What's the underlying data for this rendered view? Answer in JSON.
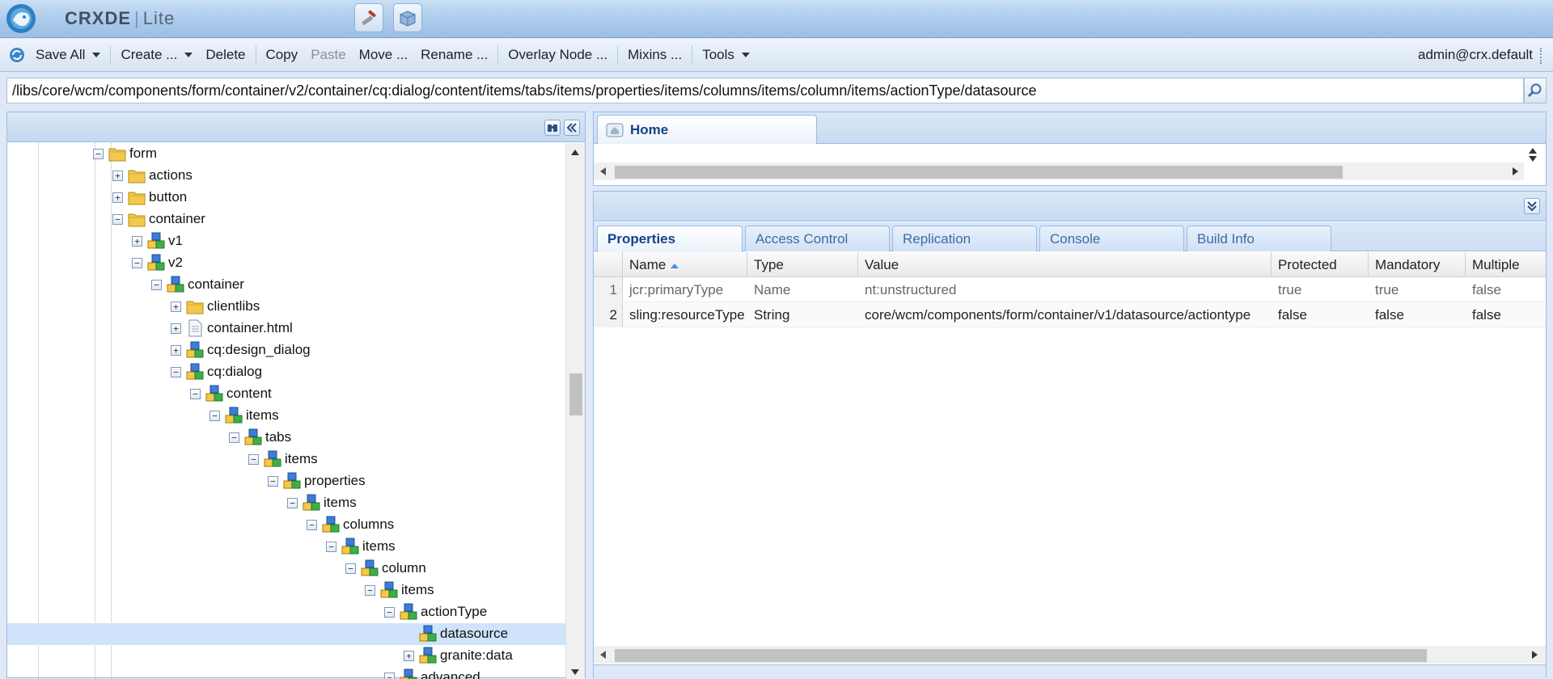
{
  "app": {
    "name_part1": "CRXDE",
    "name_part2": "Lite"
  },
  "toolbar": {
    "save_all": "Save All",
    "create": "Create ...",
    "delete": "Delete",
    "copy": "Copy",
    "paste": "Paste",
    "move": "Move ...",
    "rename": "Rename ...",
    "overlay_node": "Overlay Node ...",
    "mixins": "Mixins ...",
    "tools": "Tools",
    "user": "admin@crx.default"
  },
  "path": {
    "value": "/libs/core/wcm/components/form/container/v2/container/cq:dialog/content/items/tabs/items/properties/items/columns/items/column/items/actionType/datasource"
  },
  "tree": {
    "nodes": [
      {
        "label": "form",
        "depth": 0,
        "toggle": "minus",
        "icon": "folder"
      },
      {
        "label": "actions",
        "depth": 1,
        "toggle": "plus",
        "icon": "folder"
      },
      {
        "label": "button",
        "depth": 1,
        "toggle": "plus",
        "icon": "folder"
      },
      {
        "label": "container",
        "depth": 1,
        "toggle": "minus",
        "icon": "folder"
      },
      {
        "label": "v1",
        "depth": 2,
        "toggle": "plus",
        "icon": "node"
      },
      {
        "label": "v2",
        "depth": 2,
        "toggle": "minus",
        "icon": "node"
      },
      {
        "label": "container",
        "depth": 3,
        "toggle": "minus",
        "icon": "node"
      },
      {
        "label": "clientlibs",
        "depth": 4,
        "toggle": "plus",
        "icon": "folder"
      },
      {
        "label": "container.html",
        "depth": 4,
        "toggle": "plus",
        "icon": "file"
      },
      {
        "label": "cq:design_dialog",
        "depth": 4,
        "toggle": "plus",
        "icon": "node"
      },
      {
        "label": "cq:dialog",
        "depth": 4,
        "toggle": "minus",
        "icon": "node"
      },
      {
        "label": "content",
        "depth": 5,
        "toggle": "minus",
        "icon": "node"
      },
      {
        "label": "items",
        "depth": 6,
        "toggle": "minus",
        "icon": "node"
      },
      {
        "label": "tabs",
        "depth": 7,
        "toggle": "minus",
        "icon": "node"
      },
      {
        "label": "items",
        "depth": 8,
        "toggle": "minus",
        "icon": "node"
      },
      {
        "label": "properties",
        "depth": 9,
        "toggle": "minus",
        "icon": "node"
      },
      {
        "label": "items",
        "depth": 10,
        "toggle": "minus",
        "icon": "node"
      },
      {
        "label": "columns",
        "depth": 11,
        "toggle": "minus",
        "icon": "node"
      },
      {
        "label": "items",
        "depth": 12,
        "toggle": "minus",
        "icon": "node"
      },
      {
        "label": "column",
        "depth": 13,
        "toggle": "minus",
        "icon": "node"
      },
      {
        "label": "items",
        "depth": 14,
        "toggle": "minus",
        "icon": "node"
      },
      {
        "label": "actionType",
        "depth": 15,
        "toggle": "minus",
        "icon": "node"
      },
      {
        "label": "datasource",
        "depth": 16,
        "toggle": "none",
        "icon": "node",
        "selected": true
      },
      {
        "label": "granite:data",
        "depth": 16,
        "toggle": "plus",
        "icon": "node"
      },
      {
        "label": "advanced",
        "depth": 15,
        "toggle": "minus",
        "icon": "node"
      }
    ]
  },
  "home_tab": {
    "label": "Home"
  },
  "properties": {
    "tabs": [
      "Properties",
      "Access Control",
      "Replication",
      "Console",
      "Build Info"
    ],
    "columns": [
      "Name",
      "Type",
      "Value",
      "Protected",
      "Mandatory",
      "Multiple"
    ],
    "rows": [
      {
        "num": "1",
        "name": "jcr:primaryType",
        "type": "Name",
        "value": "nt:unstructured",
        "protected": "true",
        "mandatory": "true",
        "multiple": "false"
      },
      {
        "num": "2",
        "name": "sling:resourceType",
        "type": "String",
        "value": "core/wcm/components/form/container/v1/datasource/actiontype",
        "protected": "false",
        "mandatory": "false",
        "multiple": "false"
      }
    ]
  },
  "colors": {
    "accent": "#15428b",
    "panel_border": "#99bbe8",
    "selected_row": "#cfe4fb"
  }
}
